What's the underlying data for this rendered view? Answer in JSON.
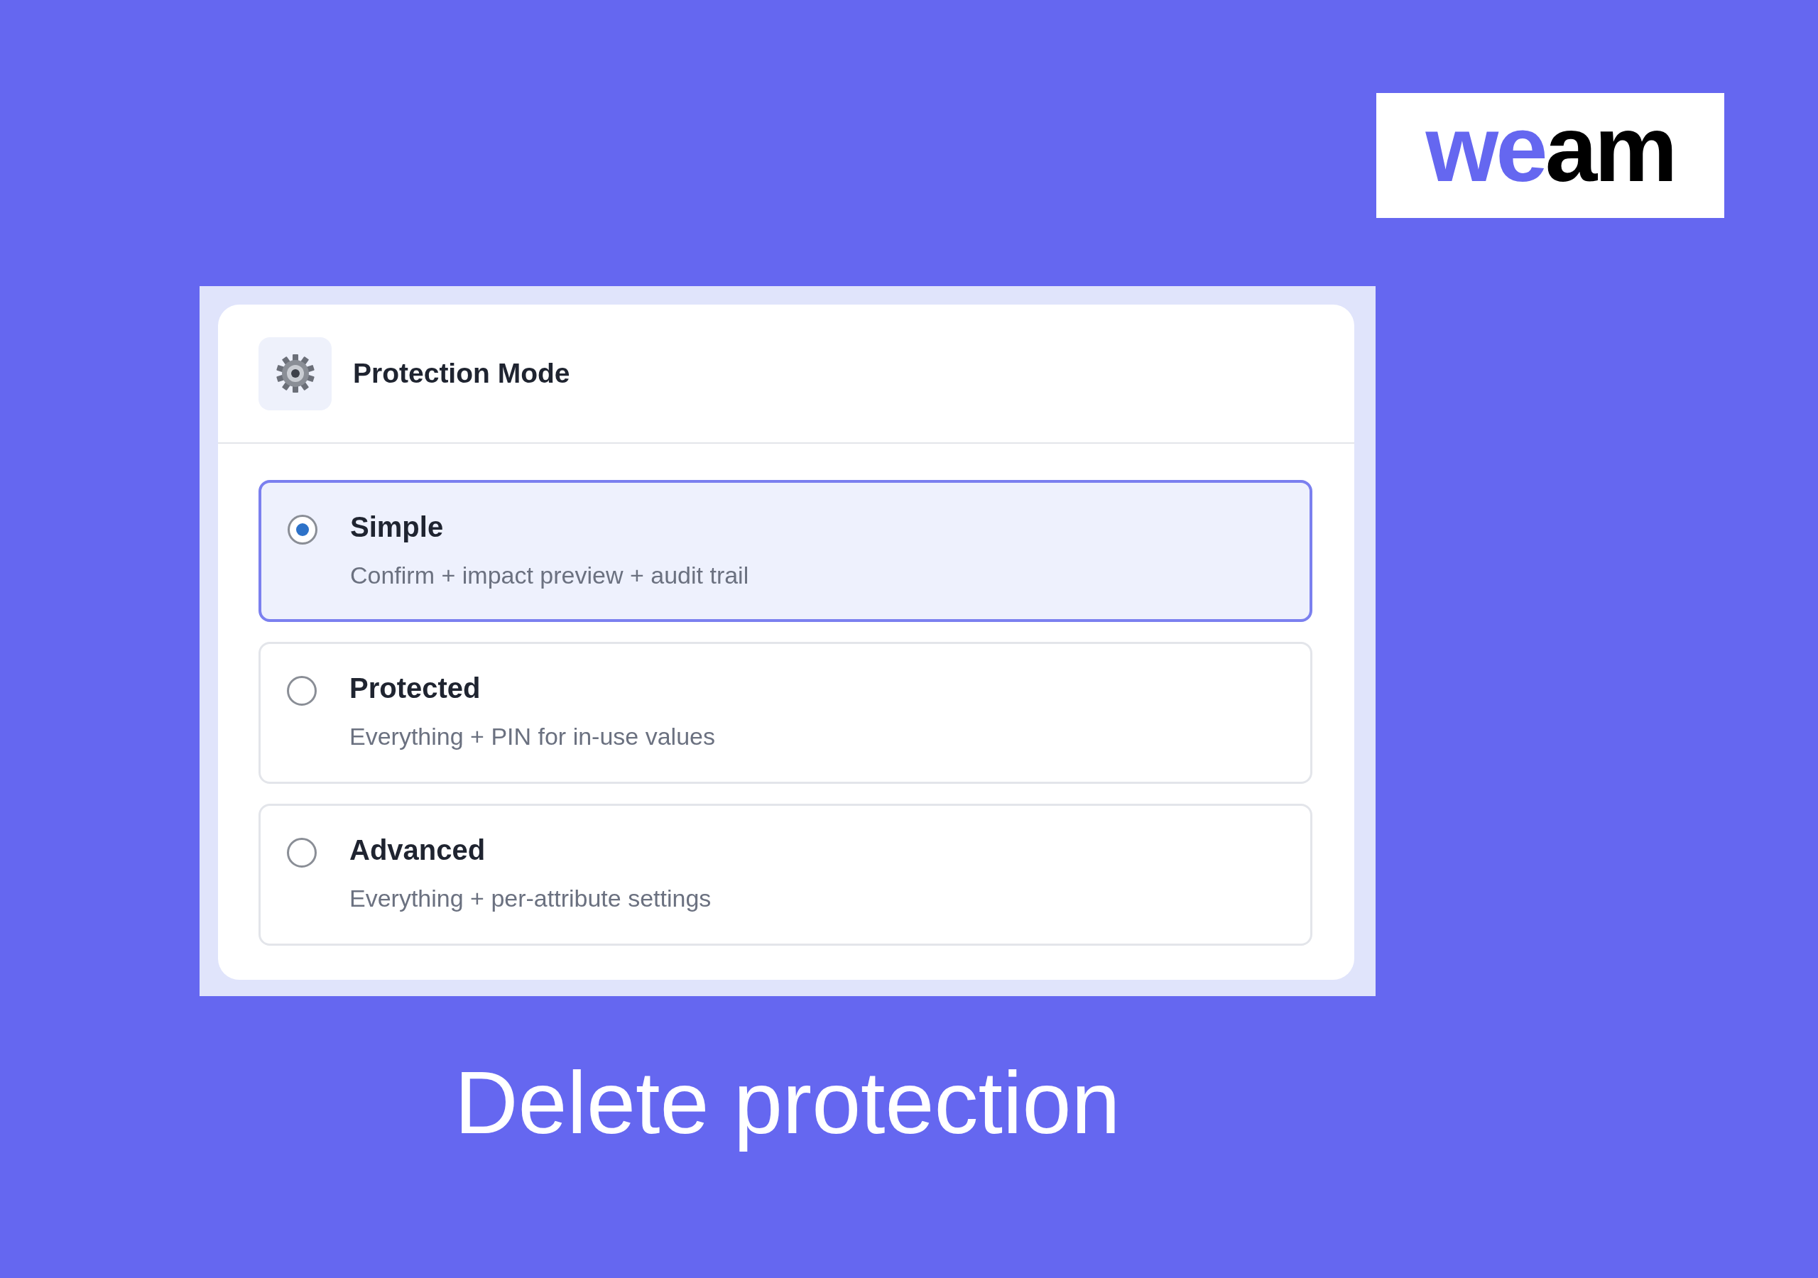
{
  "logo": {
    "parts": [
      {
        "text": "we",
        "kind": "accent"
      },
      {
        "text": "am",
        "kind": "plain"
      }
    ]
  },
  "panel": {
    "title": "Protection Mode",
    "options": [
      {
        "label": "Simple",
        "description": "Confirm + impact preview + audit trail",
        "selected": true
      },
      {
        "label": "Protected",
        "description": "Everything + PIN for in-use values",
        "selected": false
      },
      {
        "label": "Advanced",
        "description": "Everything + per-attribute settings",
        "selected": false
      }
    ]
  },
  "caption": "Delete protection"
}
